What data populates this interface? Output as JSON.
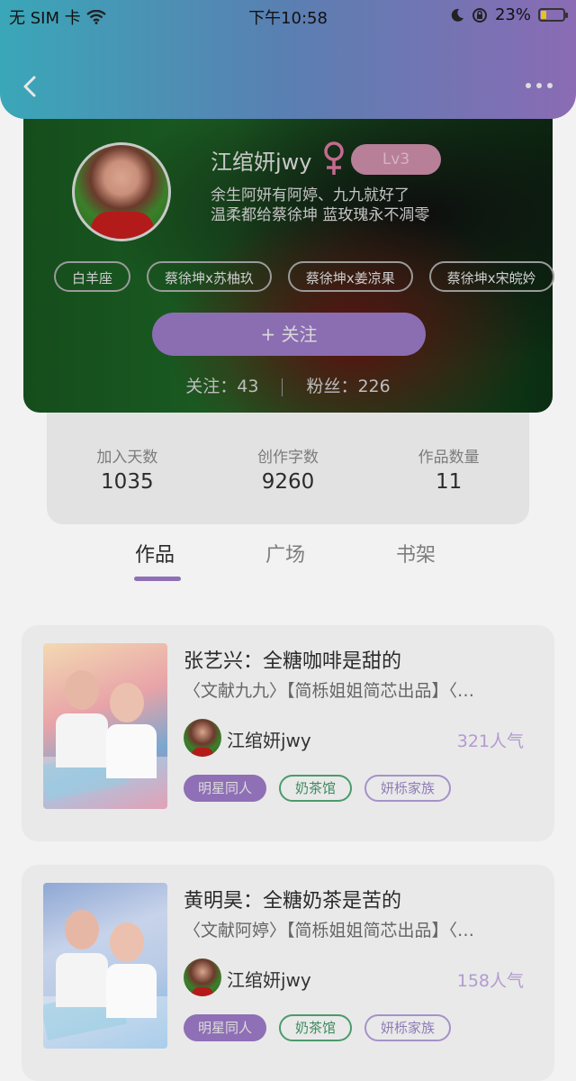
{
  "status_bar": {
    "carrier": "无 SIM 卡",
    "time": "下午10:58",
    "battery": "23%",
    "battery_level": 0.23
  },
  "header": {
    "back_icon": "chevron-left-icon",
    "more_icon": "more-horizontal-icon"
  },
  "profile": {
    "name": "江绾妍jwy",
    "gender_icon": "female-icon",
    "level": "Lv3",
    "bio_line1": "余生阿妍有阿婷、九九就好了",
    "bio_line2": "温柔都给蔡徐坤 蓝玫瑰永不凋零",
    "tags": [
      "白羊座",
      "蔡徐坤x苏柚玖",
      "蔡徐坤x姜凉果",
      "蔡徐坤x宋皖妗"
    ],
    "follow_button": "+  关注",
    "following_label": "关注：",
    "following_count": "43",
    "fans_label": "粉丝：",
    "fans_count": "226"
  },
  "stats": [
    {
      "label": "加入天数",
      "value": "1035"
    },
    {
      "label": "创作字数",
      "value": "9260"
    },
    {
      "label": "作品数量",
      "value": "11"
    }
  ],
  "tabs": [
    "作品",
    "广场",
    "书架"
  ],
  "active_tab": "作品",
  "works": [
    {
      "title": "张艺兴：全糖咖啡是甜的",
      "desc": "〈文献九九〉【简栎姐姐简芯出品】〈…",
      "author": "江绾妍jwy",
      "popularity": "321人气",
      "tags": [
        "明星同人",
        "奶茶馆",
        "妍栎家族"
      ]
    },
    {
      "title": "黄明昊：全糖奶茶是苦的",
      "desc": "〈文献阿婷〉【简栎姐姐简芯出品】〈…",
      "author": "江绾妍jwy",
      "popularity": "158人气",
      "tags": [
        "明星同人",
        "奶茶馆",
        "妍栎家族"
      ]
    }
  ],
  "colors": {
    "accent": "#8e6fb6",
    "header_start": "#3aa7b8",
    "header_end": "#8a6bb4",
    "green_tag": "#4a9a6c"
  }
}
